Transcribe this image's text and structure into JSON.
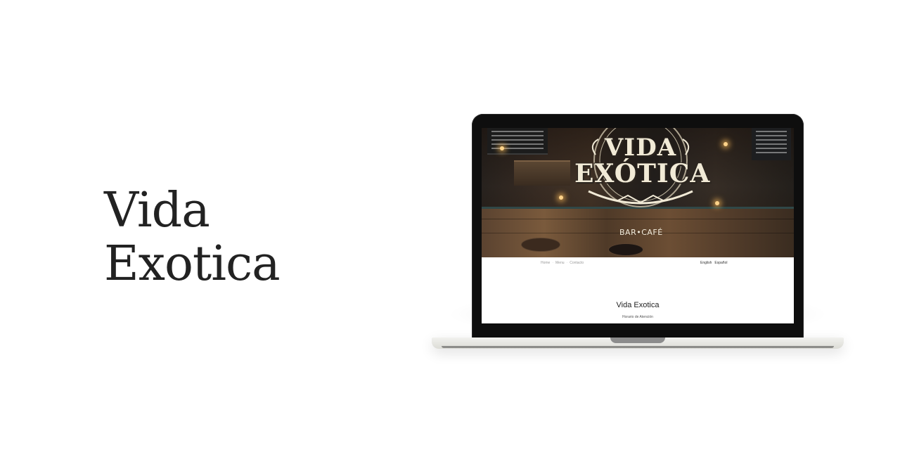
{
  "project": {
    "title_line1": "Vida",
    "title_line2": "Exotica"
  },
  "screen": {
    "hero": {
      "logo_line1": "VIDA",
      "logo_line2": "EXÓTICA",
      "logo_sub": "BAR•CAFÉ"
    },
    "nav": {
      "items": [
        "Home",
        "Menu",
        "Contacto"
      ],
      "languages": [
        "English",
        "Español"
      ]
    },
    "heading": "Vida Exotica",
    "subheading": "Horario de Atención"
  },
  "colors": {
    "title_text": "#222222",
    "bezel": "#0e0e0e",
    "logo_cream": "#f1ead6"
  }
}
